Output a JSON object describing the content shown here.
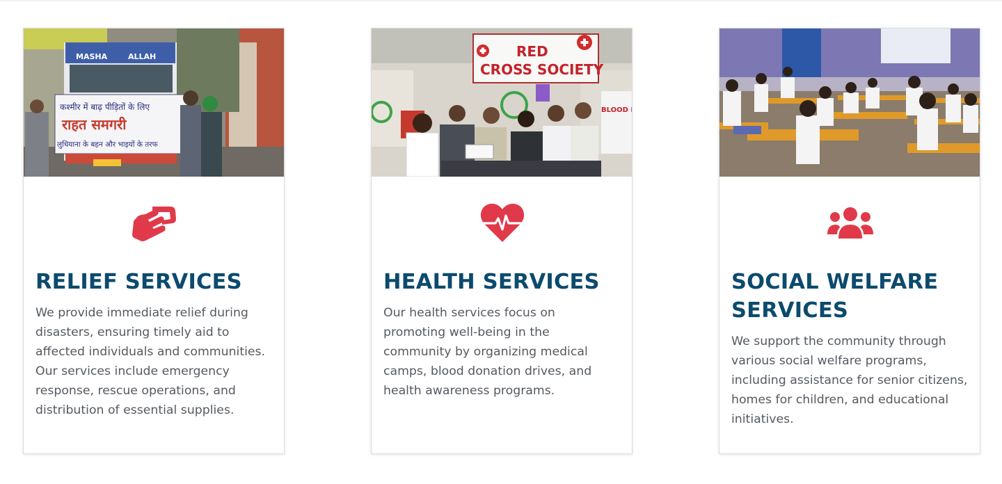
{
  "colors": {
    "heading": "#0c4a6e",
    "icon": "#e03a4a",
    "body_text": "#555a60",
    "card_border": "#dcdcdc"
  },
  "cards": [
    {
      "icon": "handshake-icon",
      "title": "RELIEF SERVICES",
      "description": "We provide immediate relief during disasters, ensuring timely aid to affected individuals and communities. Our services include emergency response, rescue operations, and distribution of essential supplies.",
      "photo_text": {
        "truck_top": "MASHA",
        "truck_top_2": "ALLAH",
        "banner_line1": "कश्मीर में बाढ़ पीड़ितों के लिए",
        "banner_line2": "राहत समगरी",
        "banner_line3": "लुधियाना के बहन और भाइयों के तरफ"
      }
    },
    {
      "icon": "heartbeat-icon",
      "title": "HEALTH SERVICES",
      "description": "Our health services focus on promoting well-being in the community by organizing medical camps, blood donation drives, and health awareness programs.",
      "photo_text": {
        "sign_line1": "RED",
        "sign_line2": "CROSS SOCIETY",
        "side_sign": "BLOOD DONATION"
      }
    },
    {
      "icon": "users-group-icon",
      "title": "SOCIAL WELFARE SERVICES",
      "description": "We support the community through various social welfare programs, including assistance for senior citizens, homes for children, and educational initiatives."
    }
  ]
}
